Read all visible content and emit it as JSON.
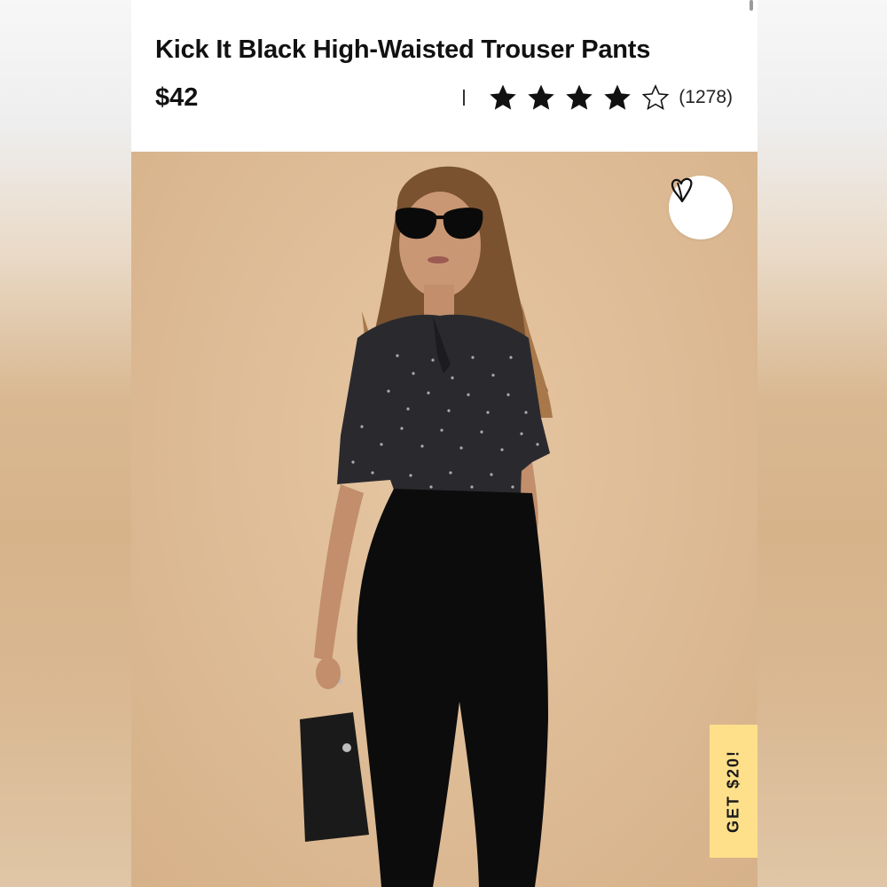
{
  "product": {
    "title": "Kick It Black High-Waisted Trouser Pants",
    "price": "$42",
    "rating": {
      "stars_filled": 4,
      "stars_total": 5,
      "review_count": "(1278)"
    }
  },
  "wishlist": {
    "icon": "heart-icon"
  },
  "promo": {
    "label": "GET $20!"
  },
  "colors": {
    "image_background": "#ddbb95",
    "promo_background": "#ffe08a",
    "star": "#111111"
  }
}
